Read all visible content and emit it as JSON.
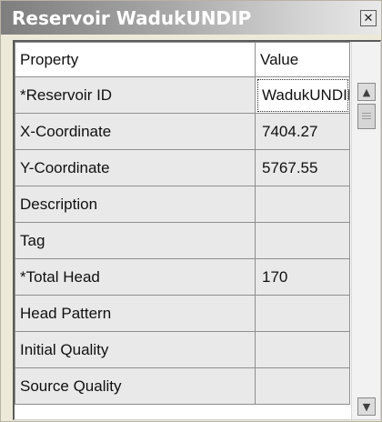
{
  "window": {
    "title": "Reservoir WadukUNDIP",
    "close_icon": "close-icon"
  },
  "grid": {
    "headers": {
      "property": "Property",
      "value": "Value"
    },
    "rows": [
      {
        "property": "*Reservoir ID",
        "value": "WadukUNDIP"
      },
      {
        "property": "X-Coordinate",
        "value": "7404.27"
      },
      {
        "property": "Y-Coordinate",
        "value": "5767.55"
      },
      {
        "property": "Description",
        "value": ""
      },
      {
        "property": "Tag",
        "value": ""
      },
      {
        "property": "*Total Head",
        "value": "170"
      },
      {
        "property": "Head Pattern",
        "value": ""
      },
      {
        "property": "Initial Quality",
        "value": ""
      },
      {
        "property": "Source Quality",
        "value": ""
      }
    ]
  },
  "scrollbar": {
    "up_icon": "chevron-up-icon",
    "down_icon": "chevron-down-icon"
  }
}
